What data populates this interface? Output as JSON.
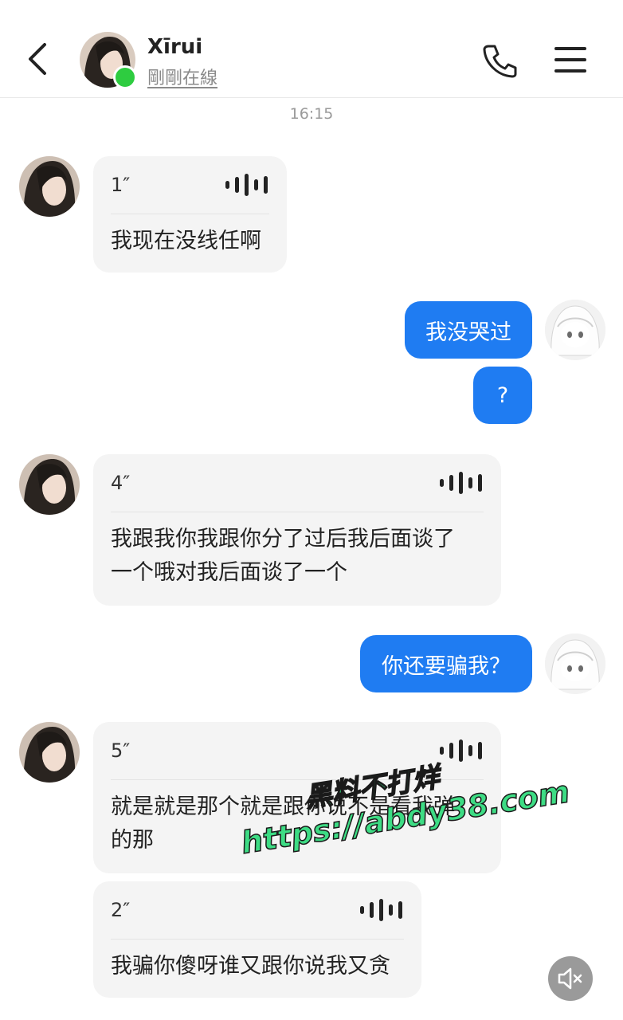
{
  "header": {
    "title": "Xīrui",
    "status": "剛剛在線"
  },
  "timestamp": "16:15",
  "messages": [
    {
      "side": "left",
      "type": "voice",
      "duration": "1″",
      "transcript": "我现在没线任啊"
    },
    {
      "side": "right",
      "type": "text",
      "text": "我没哭过"
    },
    {
      "side": "right",
      "type": "text",
      "text": "?"
    },
    {
      "side": "left",
      "type": "voice",
      "duration": "4″",
      "transcript_line1": "我跟我你我跟你分了过后我后面谈了",
      "transcript_line2": "一个哦对我后面谈了一个"
    },
    {
      "side": "right",
      "type": "text",
      "text": "你还要骗我？"
    },
    {
      "side": "left",
      "type": "voice",
      "duration": "5″",
      "transcript_line1": "就是就是那个就是跟你说不是看我弹",
      "transcript_line2": "的那"
    },
    {
      "side": "left",
      "type": "voice",
      "duration": "2″",
      "transcript": "我骗你傻呀谁又跟你说我又贪"
    }
  ],
  "watermark": {
    "line1": "黑料不打烊",
    "line2": "https://abdy38.com"
  },
  "colors": {
    "accent_blue": "#1f7cf2",
    "online_green": "#2ecc40",
    "bubble_gray": "#f4f4f4"
  },
  "icons": [
    "back-arrow-icon",
    "phone-icon",
    "menu-icon",
    "voice-wave-icon",
    "speaker-mute-icon"
  ]
}
